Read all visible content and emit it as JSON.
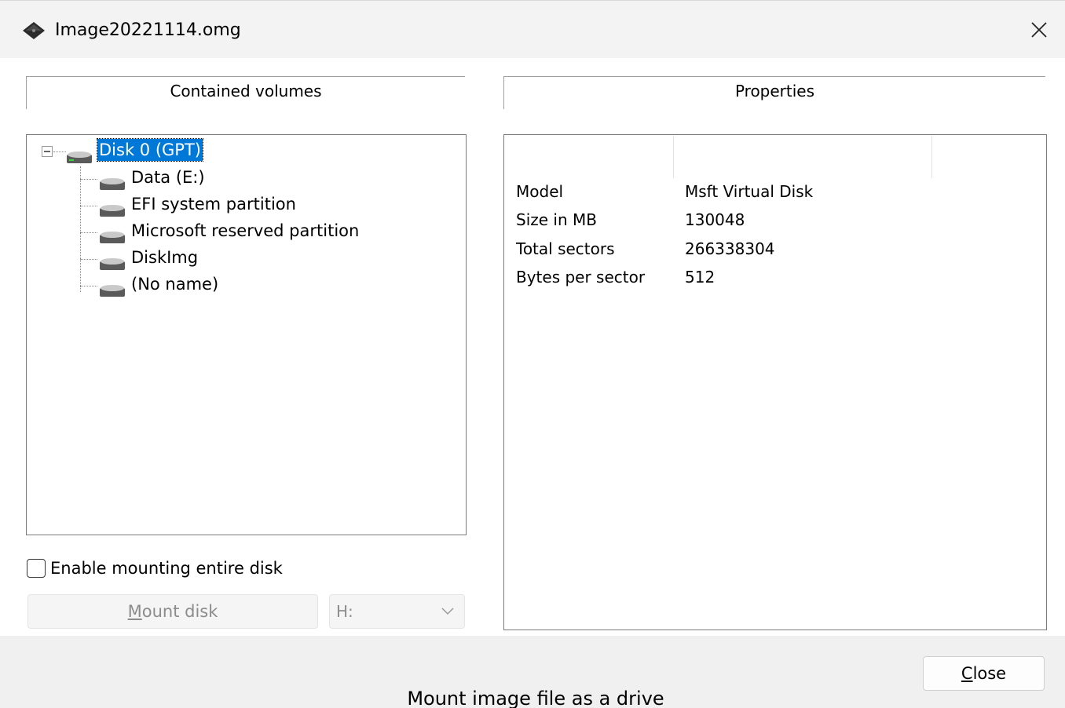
{
  "window": {
    "title": "Image20221114.omg",
    "close_glyph": "✕",
    "app_icon": "disk-image-diamond-icon"
  },
  "left_group": {
    "header": "Contained volumes",
    "tree": {
      "root": {
        "label": "Disk 0 (GPT)",
        "icon": "disk-drive-icon",
        "expanded": true,
        "selected": true
      },
      "children": [
        {
          "label": "Data (E:)",
          "icon": "disk-drive-icon"
        },
        {
          "label": "EFI system partition",
          "icon": "disk-drive-icon"
        },
        {
          "label": "Microsoft reserved partition",
          "icon": "disk-drive-icon"
        },
        {
          "label": "DiskImg",
          "icon": "disk-drive-icon"
        },
        {
          "label": "(No name)",
          "icon": "disk-drive-icon"
        }
      ]
    },
    "enable_mount_entire_disk": {
      "label": "Enable mounting entire disk",
      "checked": false
    },
    "mount_button": {
      "label_accel": "M",
      "label_rest": "ount disk",
      "enabled": false
    },
    "drive_letter_select": {
      "value": "H:",
      "enabled": false
    }
  },
  "right_group": {
    "header": "Properties",
    "properties": [
      {
        "name": "Model",
        "value": "Msft Virtual Disk"
      },
      {
        "name": "Size in MB",
        "value": "130048"
      },
      {
        "name": "Total sectors",
        "value": "266338304"
      },
      {
        "name": "Bytes per sector",
        "value": "512"
      }
    ]
  },
  "footer": {
    "close_button": {
      "label_accel": "C",
      "label_rest": "lose"
    },
    "caption": "Mount image file as a drive"
  },
  "colors": {
    "selection": "#0078d7",
    "panel_border": "#7a7a7a",
    "disabled_text": "#8c8c8c"
  }
}
